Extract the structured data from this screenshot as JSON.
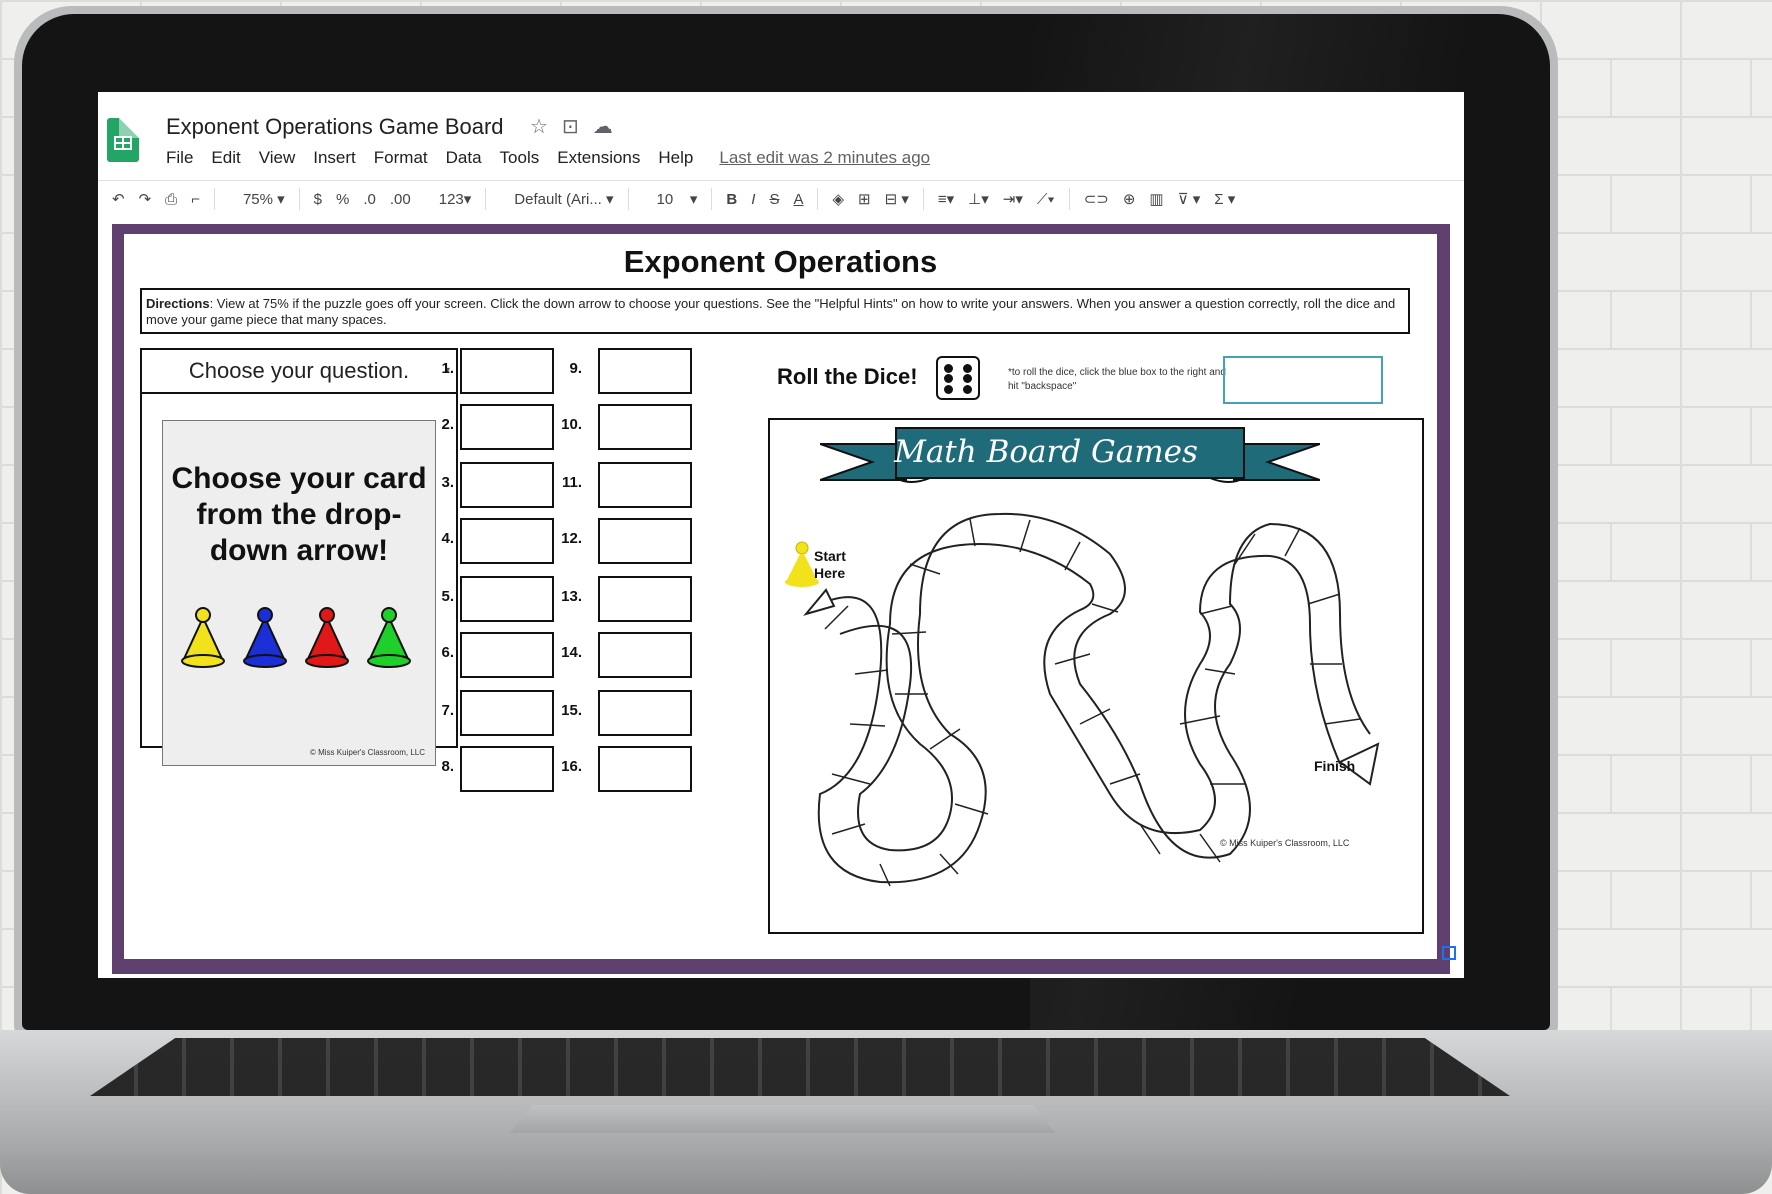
{
  "document": {
    "title": "Exponent Operations Game Board",
    "menu": [
      "File",
      "Edit",
      "View",
      "Insert",
      "Format",
      "Data",
      "Tools",
      "Extensions",
      "Help"
    ],
    "last_edit": "Last edit was 2 minutes ago"
  },
  "toolbar": {
    "zoom": "75%",
    "currency": "$",
    "percent": "%",
    "decrease_decimal": ".0",
    "increase_decimal": ".00",
    "number_format": "123",
    "font": "Default (Ari...",
    "font_size": "10",
    "bold": "B",
    "italic": "I",
    "strike": "S",
    "text_color": "A"
  },
  "sheet": {
    "title": "Exponent Operations",
    "directions_label": "Directions",
    "directions_text": ": View at 75% if the puzzle goes off your screen. Click the down arrow to choose your questions. See the \"Helpful Hints\" on how to write your answers. When you answer a question correctly, roll the dice and move your game piece that many spaces.",
    "chooser_placeholder": "Choose your question.",
    "card_text": "Choose your card from the drop-down arrow!",
    "card_copyright": "© Miss Kuiper's Classroom, LLC",
    "answer_numbers": [
      "1.",
      "2.",
      "3.",
      "4.",
      "5.",
      "6.",
      "7.",
      "8.",
      "9.",
      "10.",
      "11.",
      "12.",
      "13.",
      "14.",
      "15.",
      "16."
    ],
    "roll_title": "Roll the Dice!",
    "roll_note": "*to roll the dice, click the blue box to the right and hit \"backspace\"",
    "board_banner": "Math Board Games",
    "start_label_1": "Start",
    "start_label_2": "Here",
    "finish_label": "Finish",
    "board_copyright": "© Miss Kuiper's Classroom, LLC"
  },
  "colors": {
    "sheets_green": "#23a566",
    "sheet_border_purple": "#5e3f6e",
    "banner_teal": "#1f6b7a",
    "dice_input_border": "#43a2b8",
    "pawn_yellow": "#f2e21b",
    "pawn_blue": "#1a2fd6",
    "pawn_red": "#e01818",
    "pawn_green": "#1fcf2a"
  }
}
